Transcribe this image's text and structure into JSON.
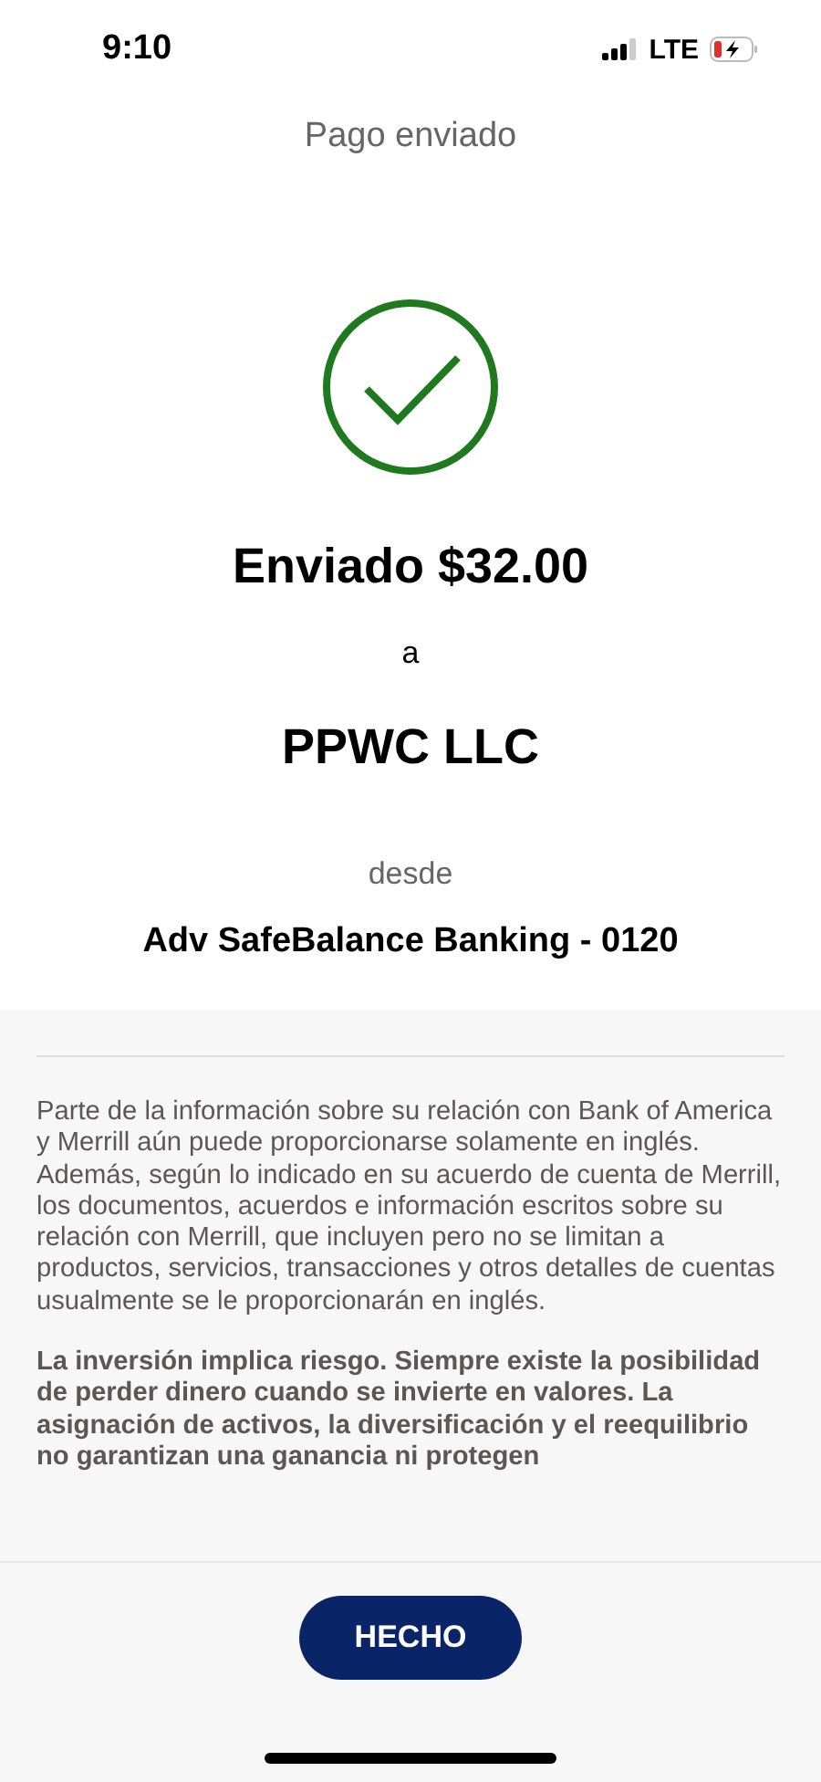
{
  "status_bar": {
    "time": "9:10",
    "network": "LTE"
  },
  "header": {
    "title": "Pago enviado"
  },
  "confirmation": {
    "sent_label": "Enviado $32.00",
    "to_label": "a",
    "payee": "PPWC LLC",
    "from_label": "desde",
    "account": "Adv SafeBalance Banking - 0120"
  },
  "disclosures": [
    {
      "kind": "plain",
      "text": "Parte de la información sobre su relación con Bank of America y Merrill aún puede proporcionarse solamente en inglés. Además, según lo indicado en su acuerdo de cuenta de Merrill, los documentos, acuerdos e información escritos sobre su relación con Merrill, que incluyen pero no se limitan a productos, servicios, transacciones y otros detalles de cuentas usualmente se le proporcionarán en inglés."
    },
    {
      "kind": "bold",
      "text": "La inversión implica riesgo. Siempre existe la posibilidad de perder dinero cuando se invierte en valores. La asignación de activos, la diversificación y el reequilibrio no garantizan una ganancia ni protegen"
    }
  ],
  "footer": {
    "button": "HECHO"
  }
}
